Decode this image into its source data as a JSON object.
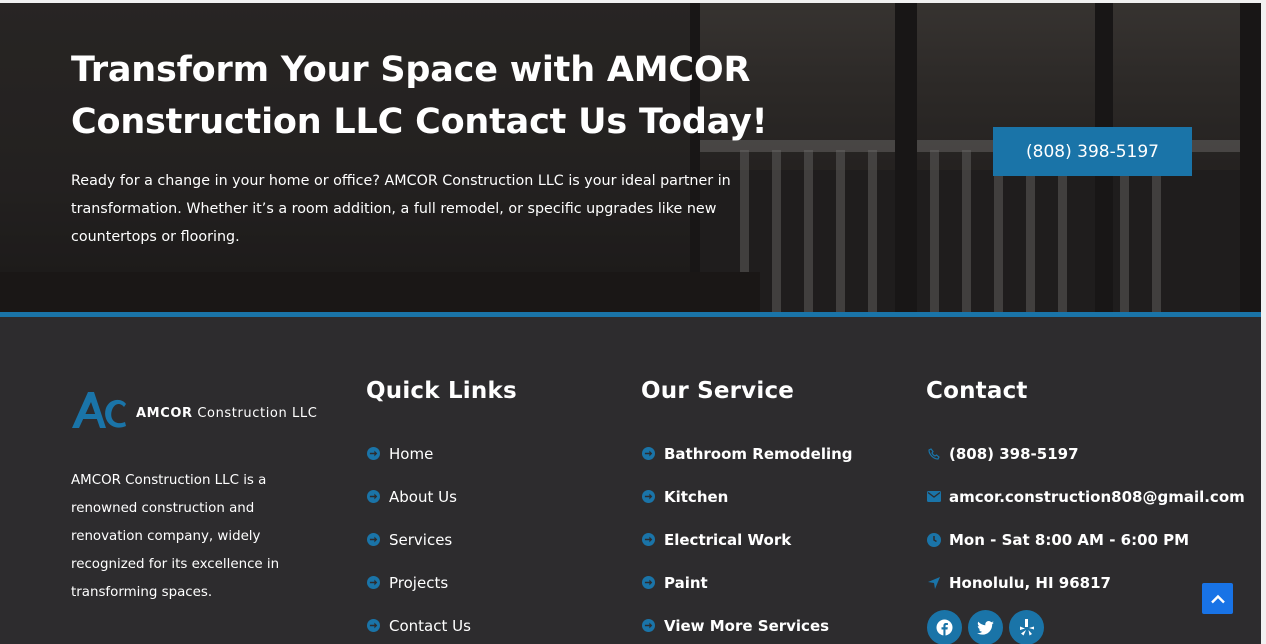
{
  "hero": {
    "title": "Transform Your Space with AMCOR Construction LLC Contact Us Today!",
    "text": "Ready for a change in your home or office? AMCOR Construction LLC is your ideal partner in transformation. Whether it’s a room addition, a full remodel, or specific upgrades like new countertops or flooring.",
    "phone_button": "(808) 398-5197"
  },
  "logo": {
    "brand": "AMCOR",
    "suffix": "Construction LLC"
  },
  "about": "AMCOR Construction LLC is a renowned construction and renovation company, widely recognized for its excellence in transforming spaces.",
  "quick_links": {
    "heading": "Quick Links",
    "items": [
      "Home",
      "About Us",
      "Services",
      "Projects",
      "Contact Us"
    ]
  },
  "services": {
    "heading": "Our Service",
    "items": [
      "Bathroom Remodeling",
      "Kitchen",
      "Electrical Work",
      "Paint",
      "View More Services"
    ]
  },
  "contact": {
    "heading": "Contact",
    "phone": "(808) 398-5197",
    "email": "amcor.construction808@gmail.com",
    "hours": "Mon - Sat 8:00 AM - 6:00 PM",
    "location": "Honolulu, HI 96817"
  },
  "socials": [
    "facebook-icon",
    "twitter-icon",
    "yelp-icon"
  ],
  "colors": {
    "accent": "#1a74a8",
    "footer_bg": "#2d2c2e",
    "back_to_top": "#1873e6"
  }
}
